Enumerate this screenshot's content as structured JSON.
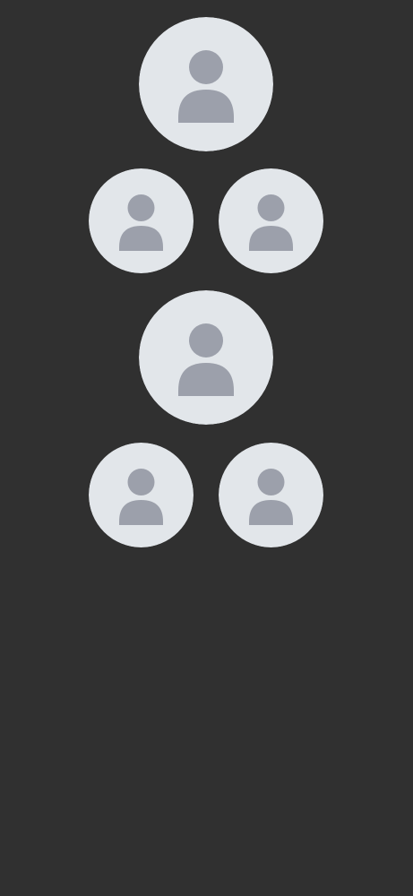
{
  "colors": {
    "background": "#303030",
    "avatar_fill": "#e2e6ea",
    "avatar_icon": "#9ca0ab"
  },
  "avatars": [
    {
      "icon": "user-icon",
      "size": "large"
    },
    {
      "icon": "user-icon",
      "size": "small"
    },
    {
      "icon": "user-icon",
      "size": "small"
    },
    {
      "icon": "user-icon",
      "size": "large"
    },
    {
      "icon": "user-icon",
      "size": "small"
    },
    {
      "icon": "user-icon",
      "size": "small"
    }
  ]
}
